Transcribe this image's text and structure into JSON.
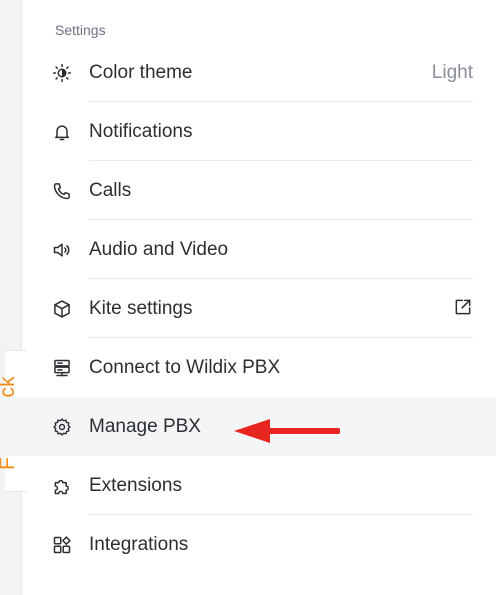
{
  "feedback": {
    "label": "Feedback"
  },
  "settings": {
    "section_title": "Settings",
    "items": [
      {
        "label": "Color theme",
        "value": "Light",
        "icon": "sun-icon"
      },
      {
        "label": "Notifications",
        "icon": "bell-icon"
      },
      {
        "label": "Calls",
        "icon": "phone-icon"
      },
      {
        "label": "Audio and Video",
        "icon": "speaker-icon"
      },
      {
        "label": "Kite settings",
        "icon": "cube-icon",
        "trailing_icon": "external-link-icon"
      },
      {
        "label": "Connect to Wildix PBX",
        "icon": "server-icon"
      },
      {
        "label": "Manage PBX",
        "icon": "gear-icon",
        "highlighted": true
      },
      {
        "label": "Extensions",
        "icon": "puzzle-icon"
      },
      {
        "label": "Integrations",
        "icon": "apps-icon"
      }
    ]
  },
  "annotation": {
    "arrow_color": "#e8251e",
    "points_to": "Manage PBX"
  },
  "colors": {
    "feedback_accent": "#f28a16",
    "text": "#2b2f33",
    "muted": "#8a9099",
    "highlight_bg": "#f4f5f7"
  }
}
